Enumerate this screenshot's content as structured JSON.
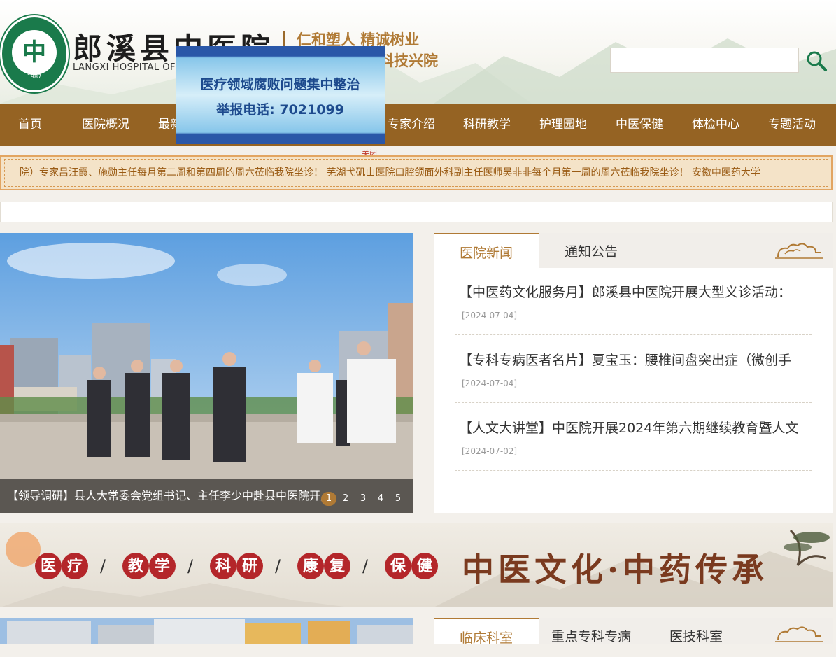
{
  "header": {
    "logo_year": "1987",
    "logo_glyph": "中",
    "hospital_name": "郎溪县中医院",
    "hospital_name_en": "LANGXI HOSPITAL OF CHINESE MEDICINE",
    "slogan_line1": "仁和塑人 精诚树业",
    "slogan_line2": "科技兴院",
    "search": {
      "placeholder": "",
      "icon": "search-icon"
    }
  },
  "nav": {
    "items": [
      {
        "label": "首页"
      },
      {
        "label": "医院概况"
      },
      {
        "label": "最新"
      },
      {
        "label": "专家介绍"
      },
      {
        "label": "科研教学"
      },
      {
        "label": "护理园地"
      },
      {
        "label": "中医保健"
      },
      {
        "label": "体检中心"
      },
      {
        "label": "专题活动"
      }
    ]
  },
  "popup": {
    "line1": "医疗领域腐败问题集中整治",
    "line2": "举报电话: 7021099",
    "close_label": "关闭"
  },
  "marquee": {
    "text": "院）专家吕汪霞、施勋主任每月第二周和第四周的周六莅临我院坐诊！ 芜湖弋矶山医院口腔颌面外科副主任医师吴非非每个月第一周的周六莅临我院坐诊！ 安徽中医药大学"
  },
  "slider": {
    "caption": "【领导调研】县人大常委会党组书记、主任李少中赴县中医院开展调研工作",
    "dots": [
      "1",
      "2",
      "3",
      "4",
      "5"
    ],
    "active_dot": 0
  },
  "news_panel": {
    "tabs": [
      {
        "label": "医院新闻"
      },
      {
        "label": "通知公告"
      }
    ],
    "items": [
      {
        "title": "【中医药文化服务月】郎溪县中医院开展大型义诊活动：",
        "date": "[2024-07-04]"
      },
      {
        "title": "【专科专病医者名片】夏宝玉：腰椎间盘突出症（微创手",
        "date": "[2024-07-04]"
      },
      {
        "title": "【人文大讲堂】中医院开展2024年第六期继续教育暨人文",
        "date": "[2024-07-02]"
      }
    ]
  },
  "banner": {
    "seals": [
      "医",
      "疗",
      "教",
      "学",
      "科",
      "研",
      "康",
      "复",
      "保",
      "健"
    ],
    "slogan": "中医文化·中药传承"
  },
  "bottom_panel": {
    "tabs": [
      {
        "label": "临床科室"
      },
      {
        "label": "重点专科专病"
      },
      {
        "label": "医技科室"
      }
    ]
  },
  "colors": {
    "nav_bg": "#956323",
    "accent": "#b07a35",
    "logo_green": "#1a7a4b",
    "seal_red": "#b4262a",
    "popup_blue": "#2a57a8"
  }
}
